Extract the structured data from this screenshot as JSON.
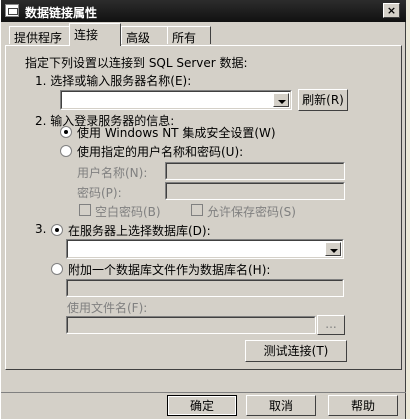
{
  "window": {
    "title": "数据链接属性",
    "close_label": "×"
  },
  "tabs": [
    {
      "label": "提供程序"
    },
    {
      "label": "连接"
    },
    {
      "label": "高级"
    },
    {
      "label": "所有"
    }
  ],
  "connection": {
    "intro": "指定下列设置以连接到 SQL Server 数据:",
    "step1": {
      "label": "1. 选择或输入服务器名称(E):",
      "server_value": "",
      "refresh_label": "刷新(R)"
    },
    "step2": {
      "label": "2. 输入登录服务器的信息:",
      "option_nt": "使用 Windows NT 集成安全设置(W)",
      "option_specific": "使用指定的用户名称和密码(U):",
      "username_label": "用户名称(N):",
      "password_label": "密码(P):",
      "blank_password_label": "空白密码(B)",
      "allow_save_label": "允许保存密码(S)"
    },
    "step3": {
      "label": "3.",
      "option_select_db": "在服务器上选择数据库(D):",
      "option_attach": "附加一个数据库文件作为数据库名(H):",
      "use_filename_label": "使用文件名(F):",
      "browse_label": "...",
      "test_label": "测试连接(T)"
    }
  },
  "footer": {
    "ok_label": "确定",
    "cancel_label": "取消",
    "help_label": "帮助"
  }
}
